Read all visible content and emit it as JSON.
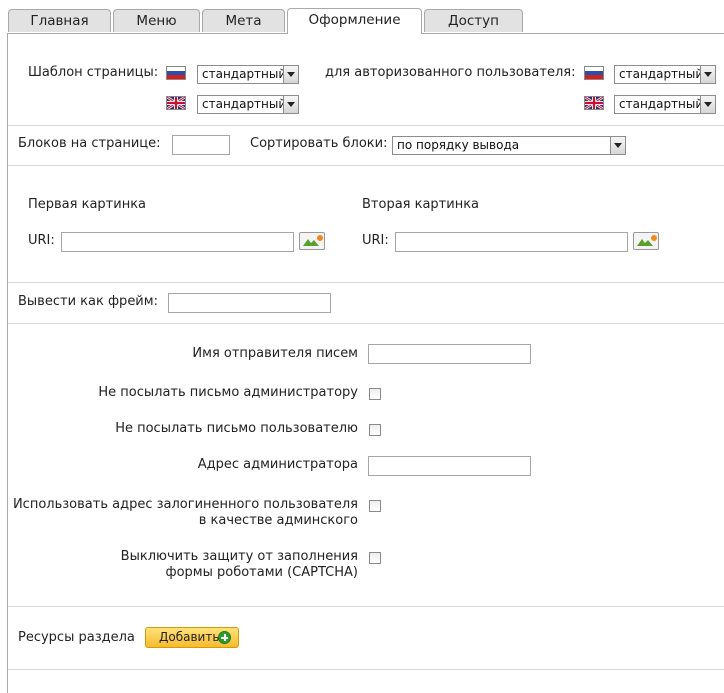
{
  "tabs": [
    {
      "label": "Главная",
      "active": false
    },
    {
      "label": "Меню",
      "active": false
    },
    {
      "label": "Мета",
      "active": false
    },
    {
      "label": "Оформление",
      "active": true
    },
    {
      "label": "Доступ",
      "active": false
    }
  ],
  "template": {
    "label": "Шаблон страницы:",
    "ru_value": "стандартный",
    "en_value": "стандартный",
    "auth_label": "для авторизованного пользователя:",
    "auth_ru_value": "стандартный",
    "auth_en_value": "стандартный"
  },
  "blocks": {
    "count_label": "Блоков на странице:",
    "count_value": "",
    "sort_label": "Сортировать блоки:",
    "sort_value": "по порядку вывода"
  },
  "images": {
    "first_label": "Первая картинка",
    "second_label": "Вторая картинка",
    "uri_label": "URI:",
    "first_uri": "",
    "second_uri": ""
  },
  "frame": {
    "label": "Вывести как фрейм:",
    "value": ""
  },
  "mail": {
    "sender_name_label": "Имя отправителя писем",
    "sender_name_value": "",
    "no_admin_mail_label": "Не посылать письмо администратору",
    "no_user_mail_label": "Не посылать письмо пользователю",
    "admin_address_label": "Адрес администратора",
    "admin_address_value": "",
    "use_login_addr_line1": "Использовать адрес залогиненного пользователя",
    "use_login_addr_line2": "в качестве админского",
    "captcha_line1": "Выключить защиту от заполнения",
    "captcha_line2": "формы роботами (CAPTCHA)"
  },
  "resources": {
    "label": "Ресурсы раздела",
    "add_label": "Добавить"
  },
  "colors": {
    "tab_bg": "#e2e2e2",
    "add_button": "#f6bb2d",
    "plus_icon": "#2c9e2c"
  }
}
